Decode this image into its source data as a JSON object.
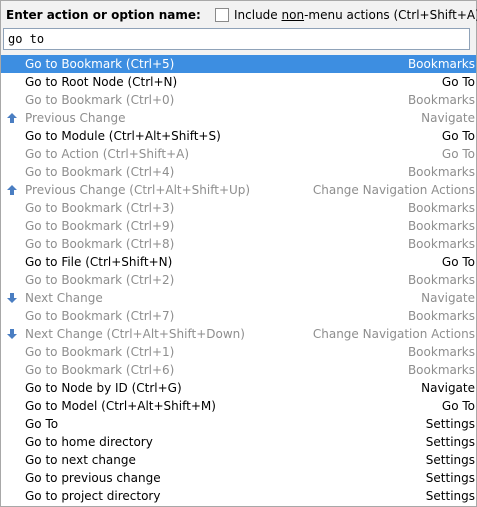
{
  "header": {
    "title": "Enter action or option name:",
    "checkbox_prefix": "Include ",
    "checkbox_underlined": "non",
    "checkbox_suffix": "-menu actions (Ctrl+Shift+A)",
    "checkbox_checked": false
  },
  "search": {
    "value": "go to"
  },
  "colors": {
    "selection": "#3d8ee1",
    "disabled_text": "#8e8e8e",
    "arrow_icon": "#4a7ec2"
  },
  "items": [
    {
      "label": "Go to Bookmark (Ctrl+5)",
      "group": "Bookmarks",
      "icon": "",
      "enabled": true,
      "selected": true
    },
    {
      "label": "Go to Root Node (Ctrl+N)",
      "group": "Go To",
      "icon": "",
      "enabled": true,
      "selected": false
    },
    {
      "label": "Go to Bookmark (Ctrl+0)",
      "group": "Bookmarks",
      "icon": "",
      "enabled": false,
      "selected": false
    },
    {
      "label": "Previous Change",
      "group": "Navigate",
      "icon": "arrow-up-icon",
      "enabled": false,
      "selected": false
    },
    {
      "label": "Go to Module (Ctrl+Alt+Shift+S)",
      "group": "Go To",
      "icon": "",
      "enabled": true,
      "selected": false
    },
    {
      "label": "Go to Action (Ctrl+Shift+A)",
      "group": "Go To",
      "icon": "",
      "enabled": false,
      "selected": false
    },
    {
      "label": "Go to Bookmark (Ctrl+4)",
      "group": "Bookmarks",
      "icon": "",
      "enabled": false,
      "selected": false
    },
    {
      "label": "Previous Change (Ctrl+Alt+Shift+Up)",
      "group": "Change Navigation Actions",
      "icon": "arrow-up-icon",
      "enabled": false,
      "selected": false
    },
    {
      "label": "Go to Bookmark (Ctrl+3)",
      "group": "Bookmarks",
      "icon": "",
      "enabled": false,
      "selected": false
    },
    {
      "label": "Go to Bookmark (Ctrl+9)",
      "group": "Bookmarks",
      "icon": "",
      "enabled": false,
      "selected": false
    },
    {
      "label": "Go to Bookmark (Ctrl+8)",
      "group": "Bookmarks",
      "icon": "",
      "enabled": false,
      "selected": false
    },
    {
      "label": "Go to File (Ctrl+Shift+N)",
      "group": "Go To",
      "icon": "",
      "enabled": true,
      "selected": false
    },
    {
      "label": "Go to Bookmark (Ctrl+2)",
      "group": "Bookmarks",
      "icon": "",
      "enabled": false,
      "selected": false
    },
    {
      "label": "Next Change",
      "group": "Navigate",
      "icon": "arrow-down-icon",
      "enabled": false,
      "selected": false
    },
    {
      "label": "Go to Bookmark (Ctrl+7)",
      "group": "Bookmarks",
      "icon": "",
      "enabled": false,
      "selected": false
    },
    {
      "label": "Next Change (Ctrl+Alt+Shift+Down)",
      "group": "Change Navigation Actions",
      "icon": "arrow-down-icon",
      "enabled": false,
      "selected": false
    },
    {
      "label": "Go to Bookmark (Ctrl+1)",
      "group": "Bookmarks",
      "icon": "",
      "enabled": false,
      "selected": false
    },
    {
      "label": "Go to Bookmark (Ctrl+6)",
      "group": "Bookmarks",
      "icon": "",
      "enabled": false,
      "selected": false
    },
    {
      "label": "Go to Node by ID (Ctrl+G)",
      "group": "Navigate",
      "icon": "",
      "enabled": true,
      "selected": false
    },
    {
      "label": "Go to Model (Ctrl+Alt+Shift+M)",
      "group": "Go To",
      "icon": "",
      "enabled": true,
      "selected": false
    },
    {
      "label": "Go To",
      "group": "Settings",
      "icon": "",
      "enabled": true,
      "selected": false
    },
    {
      "label": "Go to home directory",
      "group": "Settings",
      "icon": "",
      "enabled": true,
      "selected": false
    },
    {
      "label": "Go to next change",
      "group": "Settings",
      "icon": "",
      "enabled": true,
      "selected": false
    },
    {
      "label": "Go to previous change",
      "group": "Settings",
      "icon": "",
      "enabled": true,
      "selected": false
    },
    {
      "label": "Go to project directory",
      "group": "Settings",
      "icon": "",
      "enabled": true,
      "selected": false
    }
  ]
}
